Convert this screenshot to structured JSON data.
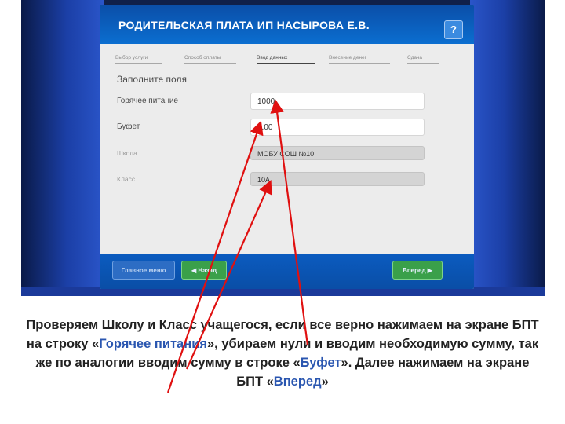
{
  "screen": {
    "title": "РОДИТЕЛЬСКАЯ ПЛАТА ИП НАСЫРОВА Е.В.",
    "help_label": "?",
    "steps": [
      "Выбор услуги",
      "Способ оплаты",
      "Ввод данных",
      "Внесение денег",
      "Сдача"
    ],
    "active_step_index": 2,
    "form_title": "Заполните поля",
    "fields": [
      {
        "label": "Горячее питание",
        "value": "1000"
      },
      {
        "label": "Буфет",
        "value": "0.00"
      },
      {
        "label": "Школа",
        "value": "МОБУ СОШ №10"
      },
      {
        "label": "Класс",
        "value": "10А"
      }
    ],
    "buttons": {
      "menu": "Главное меню",
      "back": "Назад",
      "forward": "Вперед"
    }
  },
  "caption": {
    "p1": "Проверяем Школу и Класс учащегося, если все верно нажимаем на экране БПТ на строку «",
    "hl1": "Горячее питания",
    "p2": "», убираем нули и вводим необходимую сумму, так же по аналогии вводим сумму в строке «",
    "hl2": "Буфет",
    "p3": "». Далее нажимаем на экране БПТ «",
    "hl3": "Вперед",
    "p4": "»"
  },
  "colors": {
    "header_blue": "#0b5bbf",
    "button_green": "#3aa04a",
    "annotation_red": "#e01010",
    "highlight_text": "#2a56b0"
  }
}
